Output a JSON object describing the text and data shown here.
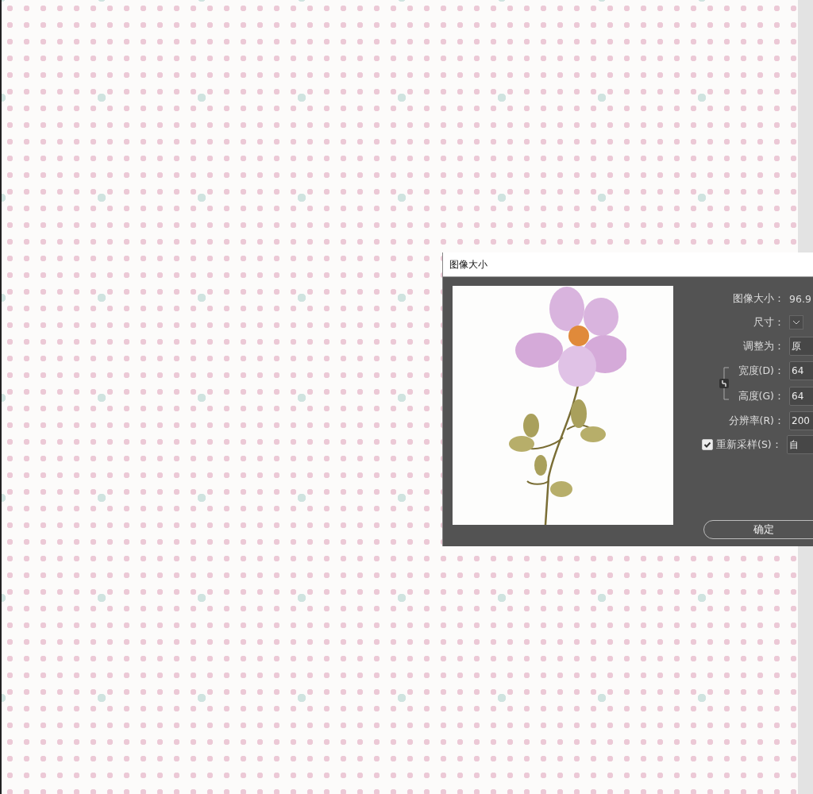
{
  "dialog": {
    "title": "图像大小",
    "image_size": {
      "label": "图像大小：",
      "value": "96.9"
    },
    "dimensions": {
      "label": "尺寸："
    },
    "fit_to": {
      "label": "调整为：",
      "value": "原"
    },
    "width": {
      "label": "宽度(D)：",
      "value": "64"
    },
    "height": {
      "label": "高度(G)：",
      "value": "64"
    },
    "resolution": {
      "label": "分辨率(R)：",
      "value": "200"
    },
    "resample": {
      "label": "重新采样(S)：",
      "checked": true,
      "value": "自"
    },
    "ok_button": "确定"
  }
}
